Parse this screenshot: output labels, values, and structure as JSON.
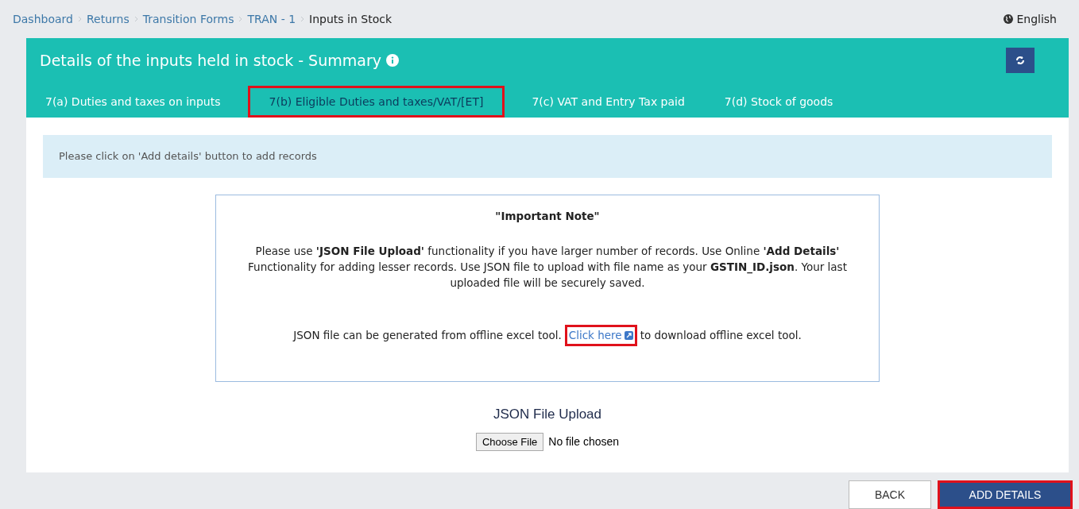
{
  "breadcrumb": [
    {
      "label": "Dashboard",
      "current": false
    },
    {
      "label": "Returns",
      "current": false
    },
    {
      "label": "Transition Forms",
      "current": false
    },
    {
      "label": "TRAN - 1",
      "current": false
    },
    {
      "label": "Inputs in Stock",
      "current": true
    }
  ],
  "language": "English",
  "panel": {
    "title": "Details of the inputs held in stock - Summary"
  },
  "tabs": [
    {
      "label": "7(a) Duties and taxes on inputs",
      "selected": false,
      "highlighted": false
    },
    {
      "label": "7(b) Eligible Duties and taxes/VAT/[ET]",
      "selected": true,
      "highlighted": true
    },
    {
      "label": "7(c) VAT and Entry Tax paid",
      "selected": false,
      "highlighted": false
    },
    {
      "label": "7(d) Stock of goods",
      "selected": false,
      "highlighted": false
    }
  ],
  "alert": "Please click on 'Add details' button to add records",
  "note": {
    "heading": "\"Important Note\"",
    "body": "Please use **'JSON File Upload'** functionality if you have larger number of records. Use Online **'Add Details'** Functionality for adding lesser records. Use JSON file to upload with file name as your **GSTIN_ID.json**. Your last uploaded file will be securely saved.",
    "line_before": "JSON file can be generated from offline excel tool.",
    "link": {
      "label": "Click here",
      "highlighted": true
    },
    "line_after": "to download offline excel tool."
  },
  "upload": {
    "label": "JSON File Upload",
    "button": "Choose File",
    "status": "No file chosen"
  },
  "buttons": [
    {
      "label": "BACK",
      "kind": "secondary",
      "highlighted": false
    },
    {
      "label": "ADD DETAILS",
      "kind": "primary",
      "highlighted": true
    }
  ]
}
